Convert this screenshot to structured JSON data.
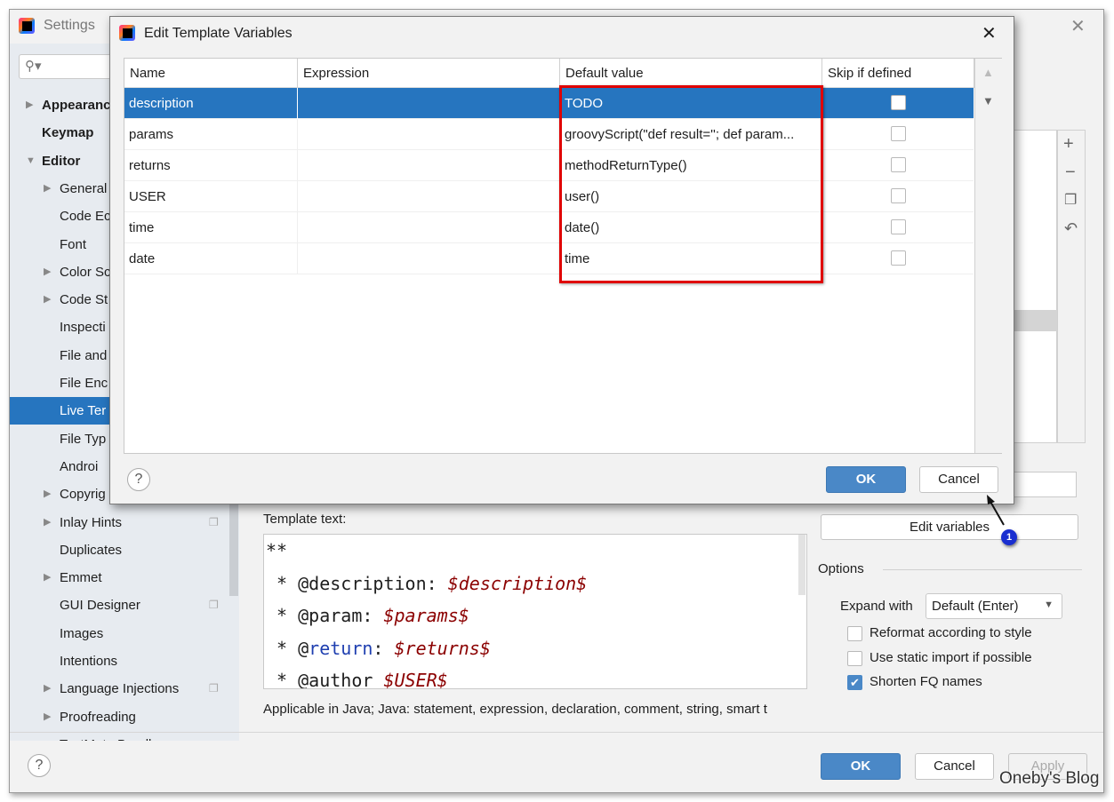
{
  "settings": {
    "title": "Settings",
    "search_placeholder": "",
    "sidebar": [
      {
        "label": "Appearanc",
        "bold": true,
        "arrow": "right"
      },
      {
        "label": "Keymap",
        "bold": true
      },
      {
        "label": "Editor",
        "bold": true,
        "arrow": "down"
      },
      {
        "label": "General",
        "arrow": "right"
      },
      {
        "label": "Code Ec"
      },
      {
        "label": "Font"
      },
      {
        "label": "Color Sc",
        "arrow": "right"
      },
      {
        "label": "Code St",
        "arrow": "right"
      },
      {
        "label": "Inspecti"
      },
      {
        "label": "File and"
      },
      {
        "label": "File Enc"
      },
      {
        "label": "Live Ter",
        "selected": true
      },
      {
        "label": "File Typ"
      },
      {
        "label": "Androi"
      },
      {
        "label": "Copyrig",
        "arrow": "right"
      },
      {
        "label": "Inlay Hints",
        "arrow": "right",
        "copy": true
      },
      {
        "label": "Duplicates"
      },
      {
        "label": "Emmet",
        "arrow": "right"
      },
      {
        "label": "GUI Designer",
        "copy": true
      },
      {
        "label": "Images"
      },
      {
        "label": "Intentions"
      },
      {
        "label": "Language Injections",
        "arrow": "right",
        "copy": true
      },
      {
        "label": "Proofreading",
        "arrow": "right"
      },
      {
        "label": "TextMate Bundles"
      }
    ],
    "template_text_label": "Template text:",
    "template_lines": [
      [
        {
          "t": "**"
        }
      ],
      [
        {
          "t": " * @description: "
        },
        {
          "t": "$description$",
          "c": "var"
        }
      ],
      [
        {
          "t": " * @param: "
        },
        {
          "t": "$params$",
          "c": "var"
        }
      ],
      [
        {
          "t": " * @"
        },
        {
          "t": "return",
          "c": "kw"
        },
        {
          "t": ": "
        },
        {
          "t": "$returns$",
          "c": "var"
        }
      ],
      [
        {
          "t": " * @author "
        },
        {
          "t": "$USER$",
          "c": "var"
        }
      ]
    ],
    "applicable_text": "Applicable in Java; Java: statement, expression, declaration, comment, string, smart t",
    "edit_variables_label": "Edit variables",
    "options_label": "Options",
    "expand_with_label": "Expand with",
    "expand_with_value": "Default (Enter)",
    "checkboxes": [
      {
        "label": "Reformat according to style",
        "checked": false
      },
      {
        "label": "Use static import if possible",
        "checked": false
      },
      {
        "label": "Shorten FQ names",
        "checked": true
      }
    ],
    "ok_label": "OK",
    "cancel_label": "Cancel",
    "apply_label": "Apply",
    "watermark": "Oneby's Blog",
    "annotation_badge": "1"
  },
  "dialog": {
    "title": "Edit Template Variables",
    "columns": [
      "Name",
      "Expression",
      "Default value",
      "Skip if defined"
    ],
    "rows": [
      {
        "name": "description",
        "expression": "",
        "default": "TODO",
        "skip": false,
        "selected": true
      },
      {
        "name": "params",
        "expression": "",
        "default": "groovyScript(\"def result=''; def param...",
        "skip": false
      },
      {
        "name": "returns",
        "expression": "",
        "default": "methodReturnType()",
        "skip": false
      },
      {
        "name": "USER",
        "expression": "",
        "default": "user()",
        "skip": false
      },
      {
        "name": "time",
        "expression": "",
        "default": "date()",
        "skip": false
      },
      {
        "name": "date",
        "expression": "",
        "default": "time",
        "skip": false
      }
    ],
    "ok_label": "OK",
    "cancel_label": "Cancel",
    "highlight_color": "#e00000"
  },
  "colors": {
    "accent": "#2675bf",
    "primary_button": "#4a88c7"
  }
}
